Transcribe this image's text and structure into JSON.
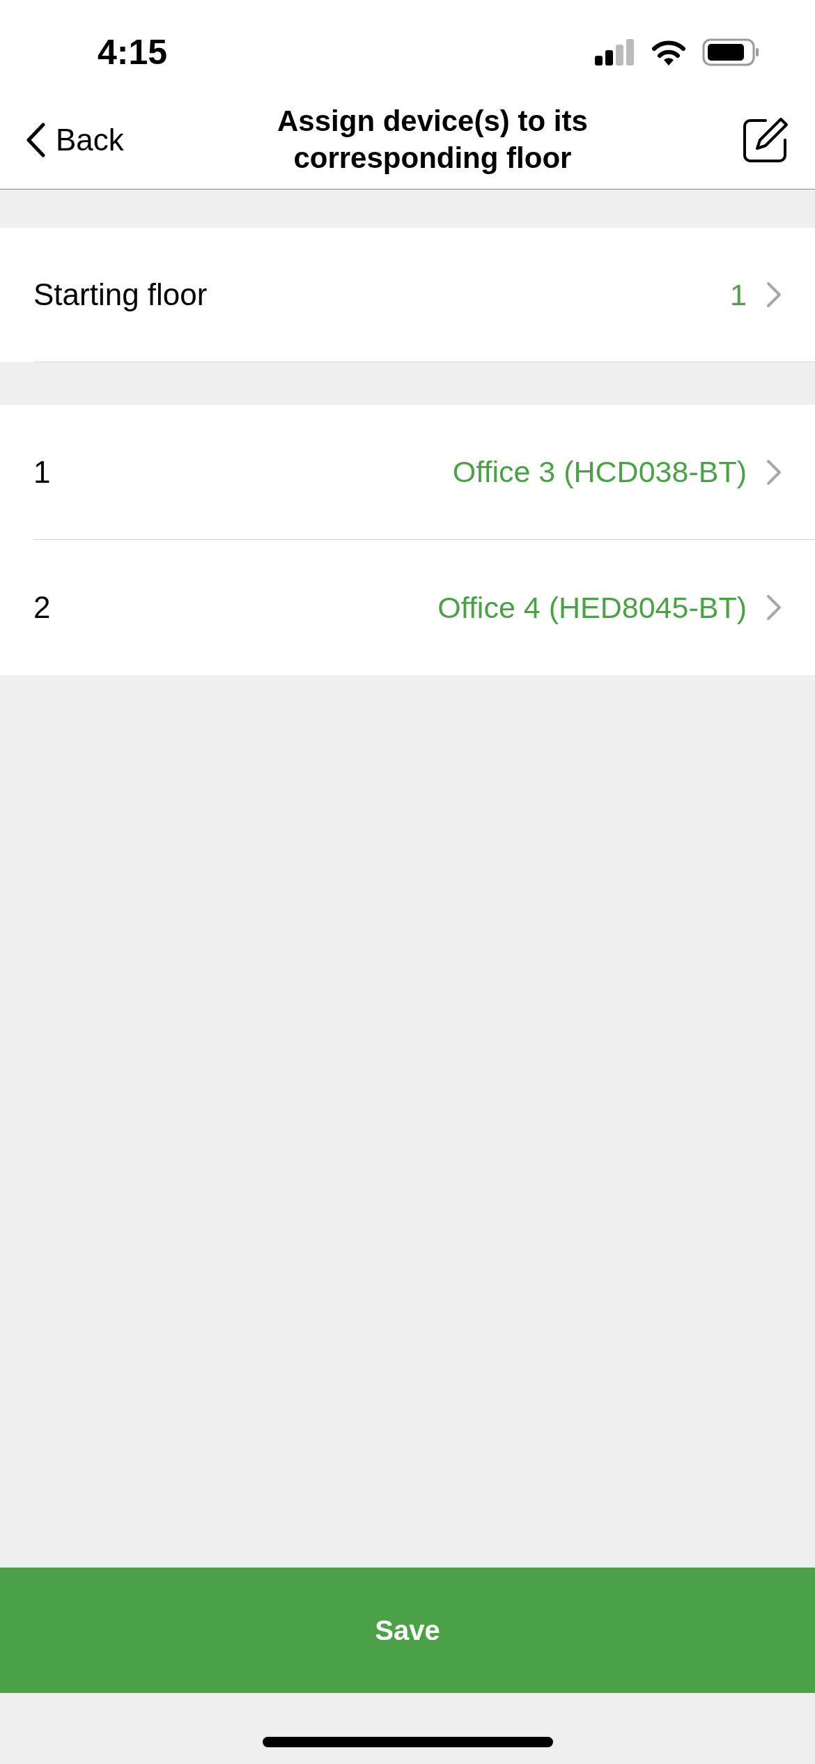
{
  "status_bar": {
    "time": "4:15"
  },
  "nav": {
    "back": "Back",
    "title": "Assign device(s) to its corresponding floor"
  },
  "starting_floor": {
    "label": "Starting floor",
    "value": "1"
  },
  "floors": [
    {
      "label": "1",
      "device": "Office 3 (HCD038-BT)"
    },
    {
      "label": "2",
      "device": "Office 4 (HED8045-BT)"
    }
  ],
  "save_button": "Save"
}
